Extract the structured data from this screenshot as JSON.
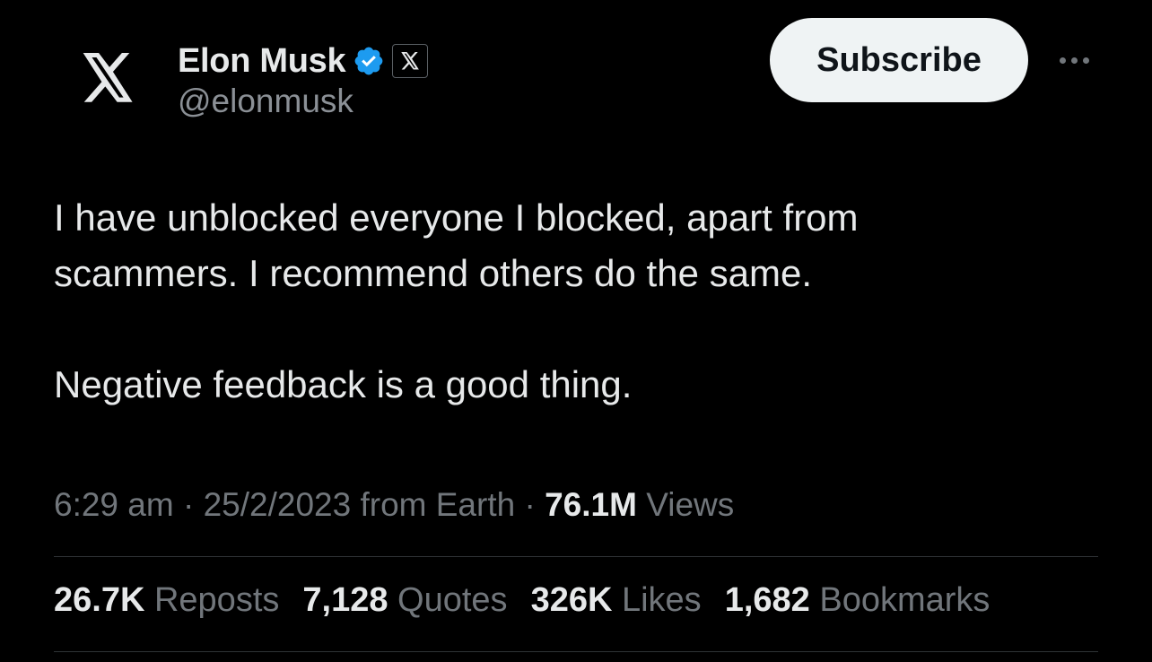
{
  "colors": {
    "background": "#000000",
    "primary_text": "#e7e9ea",
    "secondary_text": "#71767b",
    "verified_blue": "#1d9bf0",
    "subscribe_bg": "#eff3f4",
    "divider": "#2f3336"
  },
  "author": {
    "avatar_icon": "x-logo-icon",
    "display_name": "Elon Musk",
    "verified_icon": "verified-badge-icon",
    "affiliation_icon": "x-logo-icon",
    "handle": "@elonmusk"
  },
  "actions": {
    "subscribe_label": "Subscribe",
    "more_icon": "more-horizontal-icon"
  },
  "tweet": {
    "lines": [
      "I have unblocked everyone I blocked, apart from",
      "scammers. I recommend others do the same."
    ],
    "paragraph2": "Negative feedback is a good thing."
  },
  "meta": {
    "time": "6:29 am",
    "separator": "·",
    "date_source": "25/2/2023 from Earth",
    "views_count": "76.1M",
    "views_label": "Views"
  },
  "stats": [
    {
      "count": "26.7K",
      "label": "Reposts"
    },
    {
      "count": "7,128",
      "label": "Quotes"
    },
    {
      "count": "326K",
      "label": "Likes"
    },
    {
      "count": "1,682",
      "label": "Bookmarks"
    }
  ]
}
